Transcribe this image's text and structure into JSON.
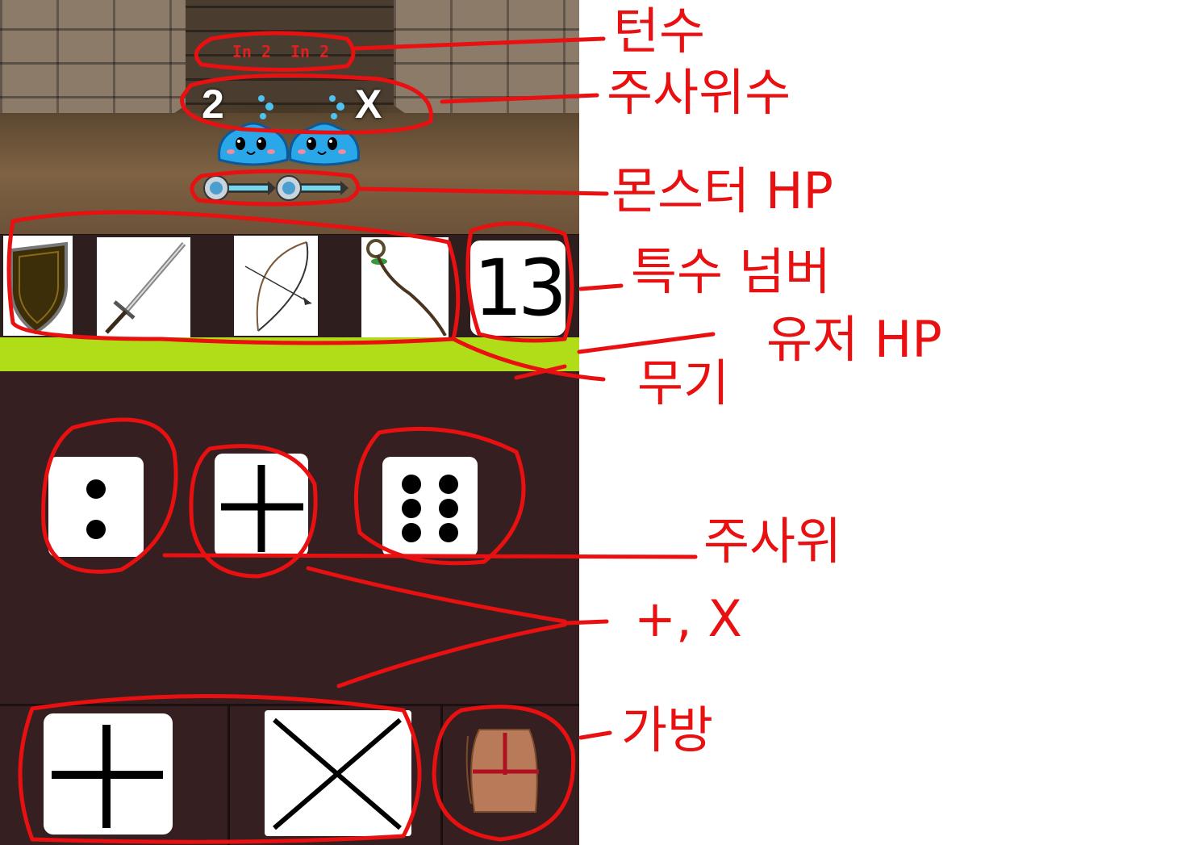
{
  "game": {
    "turn_display": [
      "In 2",
      "In 2"
    ],
    "monsters": [
      {
        "dice_value": "2"
      },
      {
        "dice_value": "X"
      }
    ],
    "special_number": "13",
    "dice": [
      {
        "pips": 2,
        "name": "dice-two"
      },
      {
        "face": "+",
        "name": "dice-plus"
      },
      {
        "pips": 6,
        "name": "dice-six"
      }
    ],
    "weapons": [
      "shield-icon",
      "sword-icon",
      "bow-icon",
      "staff-icon"
    ],
    "bottom_buttons": [
      "plus-button",
      "multiply-button",
      "bag-button"
    ],
    "colors": {
      "user_hp": "#b0dc18",
      "panel_bg": "#351f20",
      "annotation": "#e81010"
    }
  },
  "annotations": {
    "turns": "턴수",
    "dice_count": "주사위수",
    "monster_hp": "몬스터 HP",
    "special_number": "특수 넘버",
    "user_hp": "유저 HP",
    "weapon": "무기",
    "dice": "주사위",
    "operators": "+, X",
    "bag": "가방"
  }
}
